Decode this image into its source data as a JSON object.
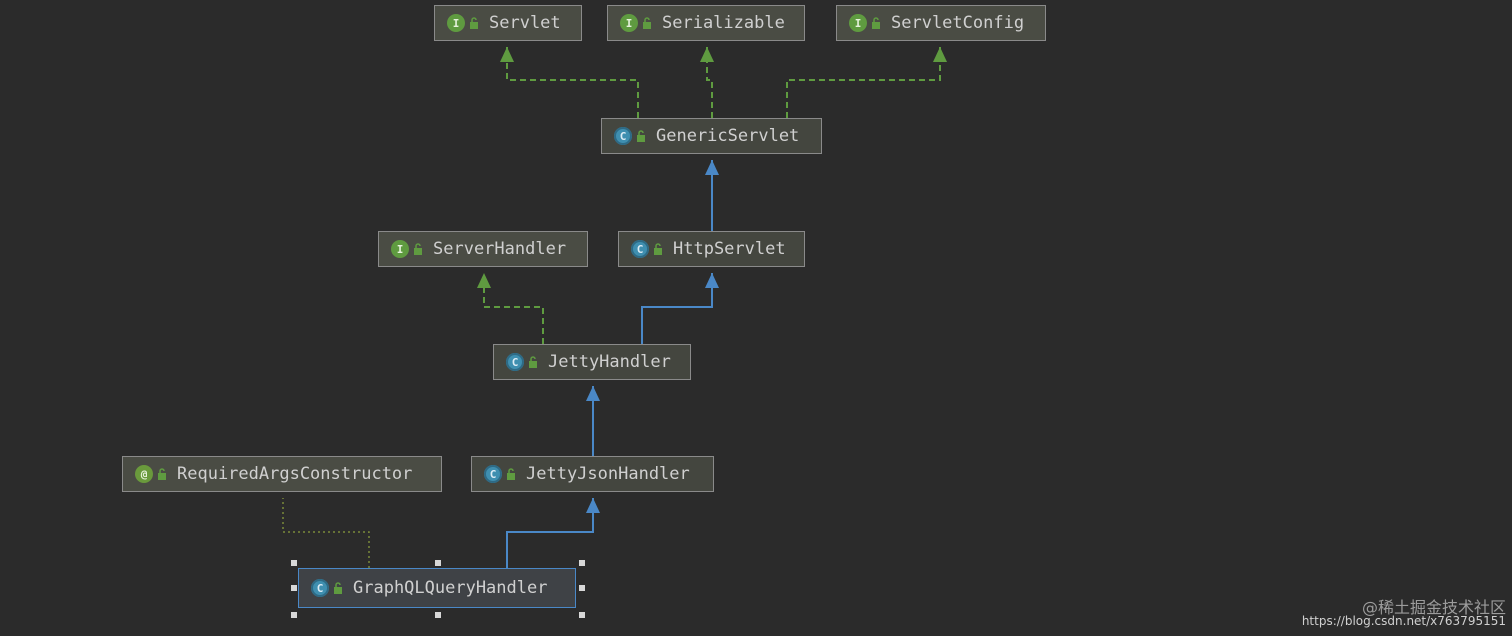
{
  "diagram": {
    "nodes": [
      {
        "id": "servlet",
        "kind": "I",
        "label": "Servlet"
      },
      {
        "id": "serializable",
        "kind": "I",
        "label": "Serializable"
      },
      {
        "id": "servletconfig",
        "kind": "I",
        "label": "ServletConfig"
      },
      {
        "id": "genericservlet",
        "kind": "C",
        "label": "GenericServlet"
      },
      {
        "id": "serverhandler",
        "kind": "I",
        "label": "ServerHandler"
      },
      {
        "id": "httpservlet",
        "kind": "C",
        "label": "HttpServlet"
      },
      {
        "id": "jettyhandler",
        "kind": "C",
        "label": "JettyHandler"
      },
      {
        "id": "requiredargs",
        "kind": "@",
        "label": "RequiredArgsConstructor"
      },
      {
        "id": "jettyjson",
        "kind": "C",
        "label": "JettyJsonHandler"
      },
      {
        "id": "graphql",
        "kind": "C",
        "label": "GraphQLQueryHandler",
        "selected": true
      }
    ],
    "edges": [
      {
        "from": "genericservlet",
        "to": "servlet",
        "type": "implements"
      },
      {
        "from": "genericservlet",
        "to": "serializable",
        "type": "implements"
      },
      {
        "from": "genericservlet",
        "to": "servletconfig",
        "type": "implements"
      },
      {
        "from": "httpservlet",
        "to": "genericservlet",
        "type": "extends"
      },
      {
        "from": "jettyhandler",
        "to": "serverhandler",
        "type": "implements"
      },
      {
        "from": "jettyhandler",
        "to": "httpservlet",
        "type": "extends"
      },
      {
        "from": "jettyjson",
        "to": "jettyhandler",
        "type": "extends"
      },
      {
        "from": "graphql",
        "to": "jettyjson",
        "type": "extends"
      },
      {
        "from": "graphql",
        "to": "requiredargs",
        "type": "annotated"
      }
    ],
    "colors": {
      "background": "#2b2b2b",
      "implements": "#5f9b40",
      "extends": "#4a88c7",
      "annotated": "#7a8a3a"
    }
  },
  "watermark": {
    "line1": "@稀土掘金技术社区",
    "line2": "https://blog.csdn.net/x763795151"
  }
}
